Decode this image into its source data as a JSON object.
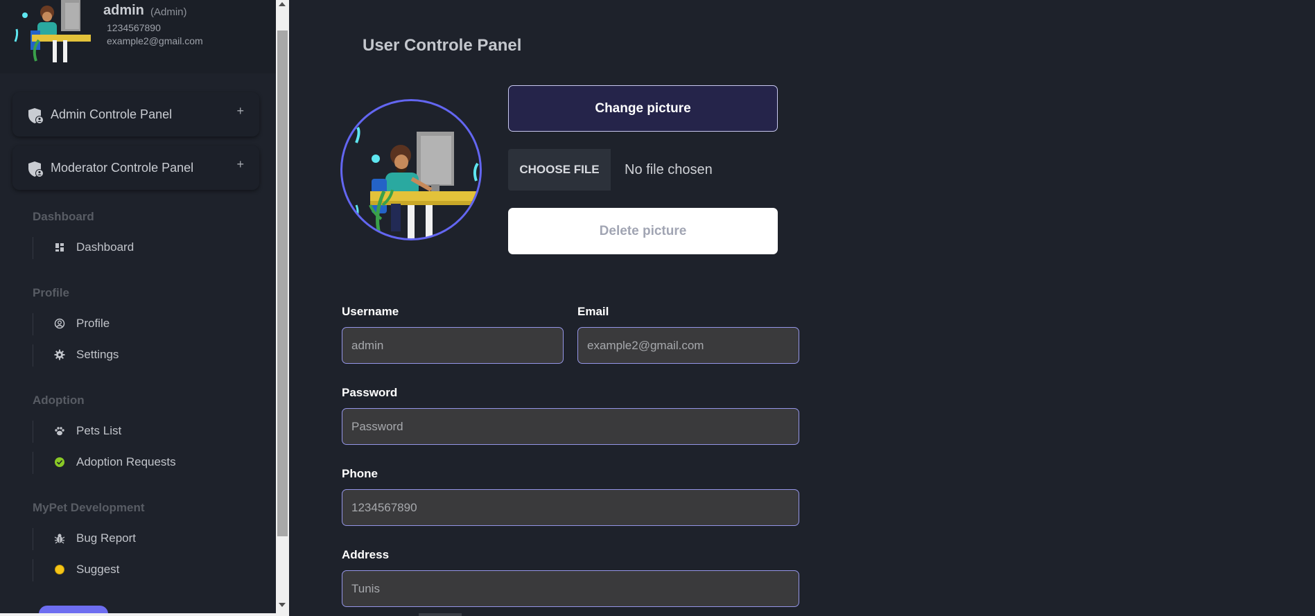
{
  "sidebar": {
    "user": {
      "name": "admin",
      "role": "(Admin)",
      "phone": "1234567890",
      "email": "example2@gmail.com"
    },
    "panels": [
      {
        "label": "Admin Controle Panel",
        "expand": "+",
        "icon": "shield-user-icon"
      },
      {
        "label": "Moderator Controle Panel",
        "expand": "+",
        "icon": "shield-user-icon"
      }
    ],
    "sections": {
      "dashboard": {
        "title": "Dashboard",
        "items": [
          {
            "label": "Dashboard",
            "icon": "grid-icon"
          }
        ]
      },
      "profile": {
        "title": "Profile",
        "items": [
          {
            "label": "Profile",
            "icon": "user-circle-icon"
          },
          {
            "label": "Settings",
            "icon": "gear-icon"
          }
        ]
      },
      "adoption": {
        "title": "Adoption",
        "items": [
          {
            "label": "Pets List",
            "icon": "paw-icon"
          },
          {
            "label": "Adoption Requests",
            "icon": "check-circle-icon",
            "color": "#8ac926"
          }
        ]
      },
      "development": {
        "title": "MyPet Development",
        "items": [
          {
            "label": "Bug Report",
            "icon": "bug-icon"
          },
          {
            "label": "Suggest",
            "icon": "lightbulb-icon",
            "color": "#f5c518"
          }
        ]
      }
    }
  },
  "main": {
    "title": "User Controle Panel",
    "change_picture": "Change picture",
    "file": {
      "button": "CHOOSE FILE",
      "status": "No file chosen"
    },
    "delete_picture": "Delete picture",
    "form": {
      "username": {
        "label": "Username",
        "value": "admin"
      },
      "email": {
        "label": "Email",
        "value": "example2@gmail.com"
      },
      "password": {
        "label": "Password",
        "placeholder": "Password"
      },
      "phone": {
        "label": "Phone",
        "value": "1234567890"
      },
      "address": {
        "label": "Address",
        "value": "Tunis"
      }
    }
  },
  "colors": {
    "accent": "#6366f1",
    "background": "#1e222b",
    "input_bg": "#3a3a3c"
  }
}
